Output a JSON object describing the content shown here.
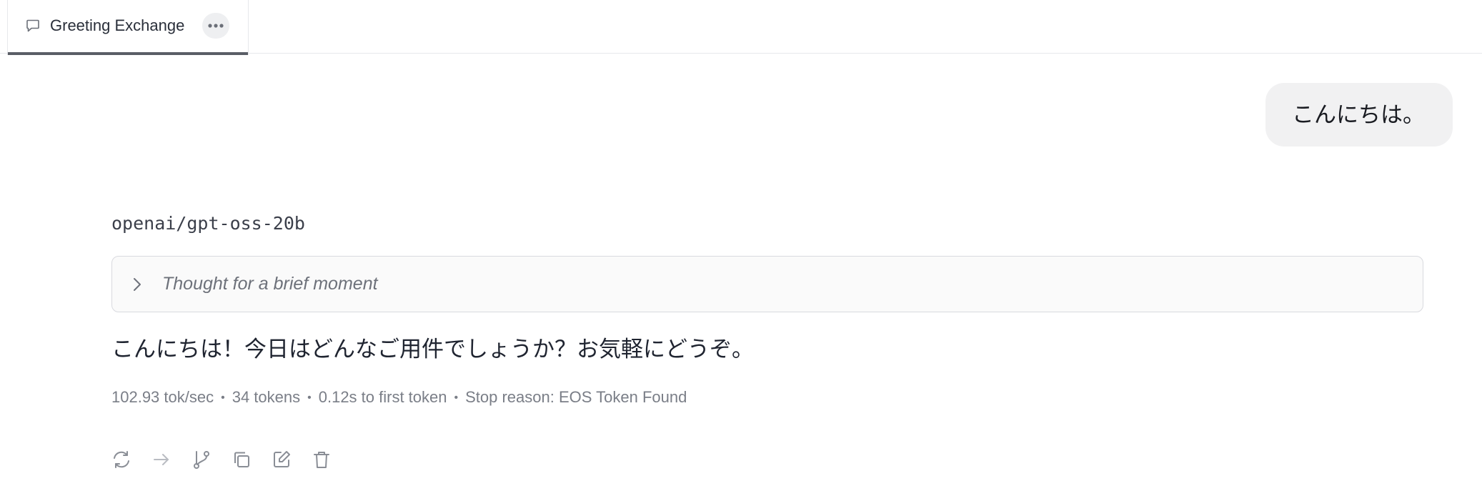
{
  "tab": {
    "title": "Greeting Exchange",
    "icon": "chat-bubble-icon",
    "more_icon": "ellipsis-icon"
  },
  "user_message": {
    "text": "こんにちは。"
  },
  "assistant": {
    "model": "openai/gpt-oss-20b",
    "thought_label": "Thought for a brief moment",
    "reply": "こんにちは！今日はどんなご用件でしょうか？お気軽にどうぞ。",
    "stats": {
      "speed": "102.93 tok/sec",
      "tokens": "34 tokens",
      "first_token": "0.12s to first token",
      "stop_reason": "Stop reason: EOS Token Found"
    },
    "actions": [
      "regenerate-icon",
      "continue-arrow-icon",
      "branch-icon",
      "copy-icon",
      "edit-icon",
      "delete-icon"
    ]
  },
  "colors": {
    "tab_underline": "#5a5e66",
    "bubble_bg": "#f1f1f2",
    "thought_bg": "#fafafa",
    "muted_text": "#7a7e87"
  }
}
